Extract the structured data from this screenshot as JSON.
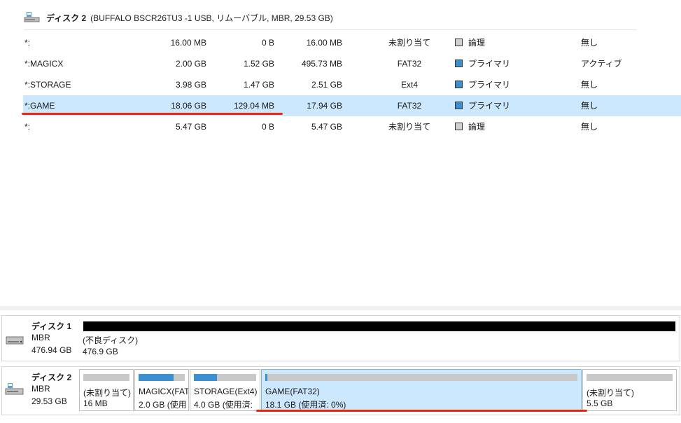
{
  "disk_header": {
    "title": "ディスク 2",
    "detail": "(BUFFALO BSCR26TU3 -1 USB, リムーバブル, MBR, 29.53 GB)",
    "icon": "usb-drive-icon"
  },
  "partitions_table": {
    "rows": [
      {
        "name": "*:",
        "capacity": "16.00 MB",
        "used": "0 B",
        "free": "16.00 MB",
        "filesystem": "未割り当て",
        "type": "論理",
        "type_color": "#d0d0d0",
        "status": "無し"
      },
      {
        "name": "*:MAGICX",
        "capacity": "2.00 GB",
        "used": "1.52 GB",
        "free": "495.73 MB",
        "filesystem": "FAT32",
        "type": "プライマリ",
        "type_color": "#3c8fce",
        "status": "アクティブ"
      },
      {
        "name": "*:STORAGE",
        "capacity": "3.98 GB",
        "used": "1.47 GB",
        "free": "2.51 GB",
        "filesystem": "Ext4",
        "type": "プライマリ",
        "type_color": "#3c8fce",
        "status": "無し"
      },
      {
        "name": "*:GAME",
        "capacity": "18.06 GB",
        "used": "129.04 MB",
        "free": "17.94 GB",
        "filesystem": "FAT32",
        "type": "プライマリ",
        "type_color": "#3c8fce",
        "status": "無し",
        "selected": true
      },
      {
        "name": "*:",
        "capacity": "5.47 GB",
        "used": "0 B",
        "free": "5.47 GB",
        "filesystem": "未割り当て",
        "type": "論理",
        "type_color": "#d0d0d0",
        "status": "無し"
      }
    ]
  },
  "disk1": {
    "name": "ディスク 1",
    "scheme": "MBR",
    "size": "476.94 GB",
    "icon": "hard-drive-icon",
    "partition": {
      "label": "(不良ディスク)",
      "size": "476.9 GB"
    }
  },
  "disk2": {
    "name": "ディスク 2",
    "scheme": "MBR",
    "size": "29.53 GB",
    "icon": "usb-drive-icon",
    "partitions": [
      {
        "label": "(未割り当て)",
        "size": "16 MB",
        "used_fraction": 0
      },
      {
        "label": "MAGICX(FAT",
        "size": "2.0 GB (使用",
        "used_fraction": 0.76
      },
      {
        "label": "STORAGE(Ext4)",
        "size": "4.0 GB (使用済:",
        "used_fraction": 0.37
      },
      {
        "label": "GAME(FAT32)",
        "size": "18.1 GB (使用済: 0%)",
        "used_fraction": 0.007,
        "selected": true
      },
      {
        "label": "(未割り当て)",
        "size": "5.5 GB",
        "used_fraction": 0
      }
    ]
  },
  "colors": {
    "accent": "#3c8fce",
    "selection": "#cce8ff",
    "annotation": "#e8280e"
  }
}
